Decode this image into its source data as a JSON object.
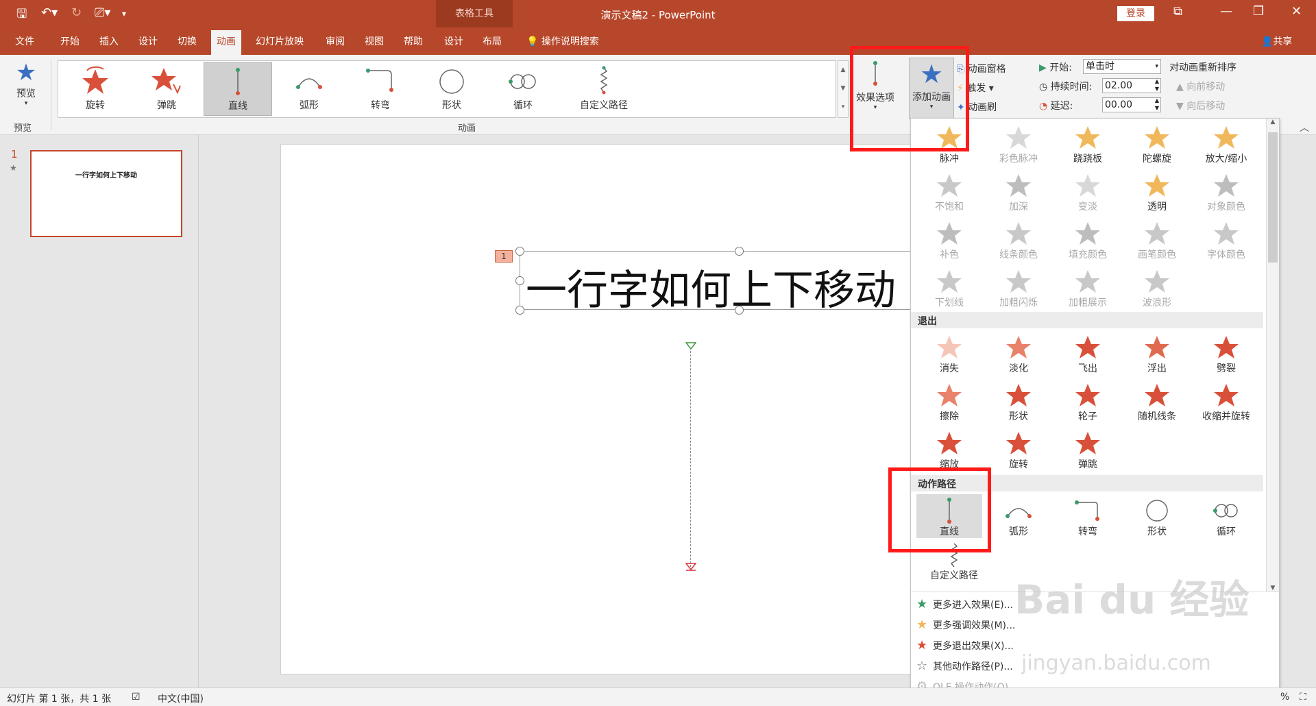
{
  "titlebar": {
    "context_tools": "表格工具",
    "title": "演示文稿2 - PowerPoint",
    "login": "登录"
  },
  "tabs": [
    {
      "label": "文件"
    },
    {
      "label": "开始"
    },
    {
      "label": "插入"
    },
    {
      "label": "设计"
    },
    {
      "label": "切换"
    },
    {
      "label": "动画"
    },
    {
      "label": "幻灯片放映"
    },
    {
      "label": "审阅"
    },
    {
      "label": "视图"
    },
    {
      "label": "帮助"
    },
    {
      "label": "设计"
    },
    {
      "label": "布局"
    }
  ],
  "search": "操作说明搜索",
  "share": "共享",
  "ribbon": {
    "preview_label": "预览",
    "preview_group": "预览",
    "animation_group": "动画",
    "gallery": [
      "旋转",
      "弹跳",
      "直线",
      "弧形",
      "转弯",
      "形状",
      "循环",
      "自定义路径"
    ],
    "effect_options": "效果选项",
    "add_animation": "添加动画",
    "animation_pane": "动画窗格",
    "trigger": "触发",
    "animation_painter": "动画刷",
    "start_label": "开始:",
    "start_value": "单击时",
    "duration_label": "持续时间:",
    "duration_value": "02.00",
    "delay_label": "延迟:",
    "delay_value": "00.00",
    "reorder_title": "对动画重新排序",
    "move_earlier": "向前移动",
    "move_later": "向后移动"
  },
  "thumbnail": {
    "number": "1",
    "text": "一行字如何上下移动"
  },
  "slide": {
    "text": "一行字如何上下移动",
    "anim_tag": "1"
  },
  "dropdown": {
    "emphasis": [
      {
        "label": "脉冲",
        "color": "#f0b85a",
        "disabled": false
      },
      {
        "label": "彩色脉冲",
        "color": "#d8d8d8",
        "disabled": true
      },
      {
        "label": "跷跷板",
        "color": "#f0b85a",
        "disabled": false
      },
      {
        "label": "陀螺旋",
        "color": "#f0b85a",
        "disabled": false
      },
      {
        "label": "放大/缩小",
        "color": "#f0b85a",
        "disabled": false
      },
      {
        "label": "不饱和",
        "color": "#c8c8c8",
        "disabled": true
      },
      {
        "label": "加深",
        "color": "#bdbdbd",
        "disabled": true
      },
      {
        "label": "变淡",
        "color": "#d8d8d8",
        "disabled": true
      },
      {
        "label": "透明",
        "color": "#f0b85a",
        "disabled": false
      },
      {
        "label": "对象颜色",
        "color": "#bdbdbd",
        "disabled": true
      },
      {
        "label": "补色",
        "color": "#bdbdbd",
        "disabled": true
      },
      {
        "label": "线条颜色",
        "color": "#c8c8c8",
        "disabled": true
      },
      {
        "label": "填充颜色",
        "color": "#bdbdbd",
        "disabled": true
      },
      {
        "label": "画笔颜色",
        "color": "#c8c8c8",
        "disabled": true
      },
      {
        "label": "字体颜色",
        "color": "#c8c8c8",
        "disabled": true
      },
      {
        "label": "下划线",
        "color": "#c8c8c8",
        "disabled": true
      },
      {
        "label": "加粗闪烁",
        "color": "#c8c8c8",
        "disabled": true
      },
      {
        "label": "加粗展示",
        "color": "#c8c8c8",
        "disabled": true
      },
      {
        "label": "波浪形",
        "color": "#c8c8c8",
        "disabled": true
      }
    ],
    "exit_header": "退出",
    "exit": [
      {
        "label": "消失",
        "color": "#f5c6b8"
      },
      {
        "label": "淡化",
        "color": "#e8826a"
      },
      {
        "label": "飞出",
        "color": "#d9503a"
      },
      {
        "label": "浮出",
        "color": "#e06a50"
      },
      {
        "label": "劈裂",
        "color": "#d9503a"
      },
      {
        "label": "擦除",
        "color": "#e8826a"
      },
      {
        "label": "形状",
        "color": "#d9503a"
      },
      {
        "label": "轮子",
        "color": "#d9503a"
      },
      {
        "label": "随机线条",
        "color": "#d9503a"
      },
      {
        "label": "收缩并旋转",
        "color": "#d9503a"
      },
      {
        "label": "缩放",
        "color": "#d9503a"
      },
      {
        "label": "旋转",
        "color": "#d9503a"
      },
      {
        "label": "弹跳",
        "color": "#d9503a"
      }
    ],
    "motion_header": "动作路径",
    "motion": [
      "直线",
      "弧形",
      "转弯",
      "形状",
      "循环"
    ],
    "custom_path": "自定义路径",
    "more": [
      {
        "label": "更多进入效果(E)...",
        "color": "#3a9a6a",
        "disabled": false
      },
      {
        "label": "更多强调效果(M)...",
        "color": "#f0b85a",
        "disabled": false
      },
      {
        "label": "更多退出效果(X)...",
        "color": "#d9503a",
        "disabled": false
      },
      {
        "label": "其他动作路径(P)...",
        "color": "#777777",
        "disabled": false
      },
      {
        "label": "OLE 操作动作(O)...",
        "color": "#bbbbbb",
        "disabled": true
      }
    ]
  },
  "statusbar": {
    "slide_info": "幻灯片 第 1 张，共 1 张",
    "language": "中文(中国)",
    "zoom_suffix": "%"
  },
  "watermark": {
    "main": "Bai du 经验",
    "sub": "jingyan.baidu.com"
  }
}
